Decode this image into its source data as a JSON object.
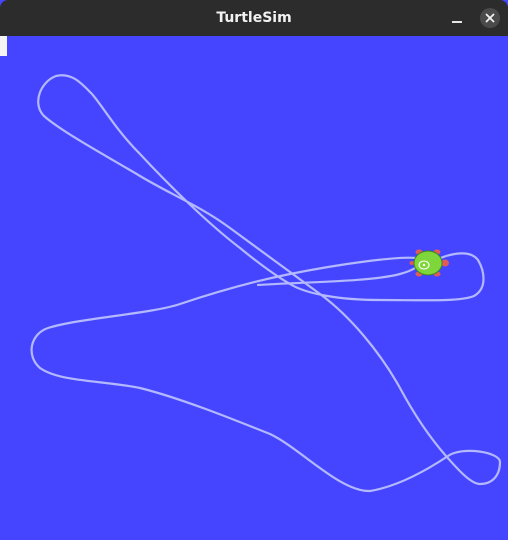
{
  "window": {
    "title": "TurtleSim",
    "background_color": "#4545ff",
    "titlebar_color": "#2c2c2c"
  },
  "controls": {
    "minimize_icon": "minimize-icon",
    "close_icon": "close-icon"
  },
  "canvas": {
    "pen_color": "#b3b8ff",
    "turtle": {
      "icon": "turtle-icon",
      "shell_color": "#7ed63a",
      "limb_color": "#e05a5a"
    }
  }
}
